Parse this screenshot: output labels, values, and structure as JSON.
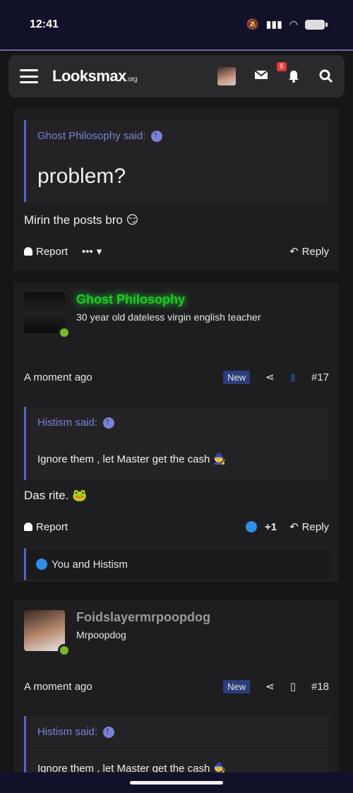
{
  "status": {
    "time": "12:41"
  },
  "nav": {
    "logo": "Looksmax",
    "logo_suffix": ".org",
    "notification_count": "6"
  },
  "post1": {
    "quote_author": "Ghost Philosophy said:",
    "quote_text": "problem?",
    "text": "Mirin the posts bro",
    "report": "Report",
    "more": "•••",
    "reply": "Reply"
  },
  "post2": {
    "author": "Ghost Philosophy",
    "author_title": "30 year old dateless virgin english teacher",
    "time": "A moment ago",
    "badge": "New",
    "number": "#17",
    "quote_author": "Histism said:",
    "quote_text": "Ignore them , let Master get the cash",
    "text": "Das rite.",
    "report": "Report",
    "likes": "+1",
    "reply": "Reply",
    "reactions": "You and Histism"
  },
  "post3": {
    "author": "Foidslayermrpoopdog",
    "author_title": "Mrpoopdog",
    "time": "A moment ago",
    "badge": "New",
    "number": "#18",
    "quote_author": "Histism said:",
    "quote_text": "Ignore them , let Master get the cash"
  }
}
